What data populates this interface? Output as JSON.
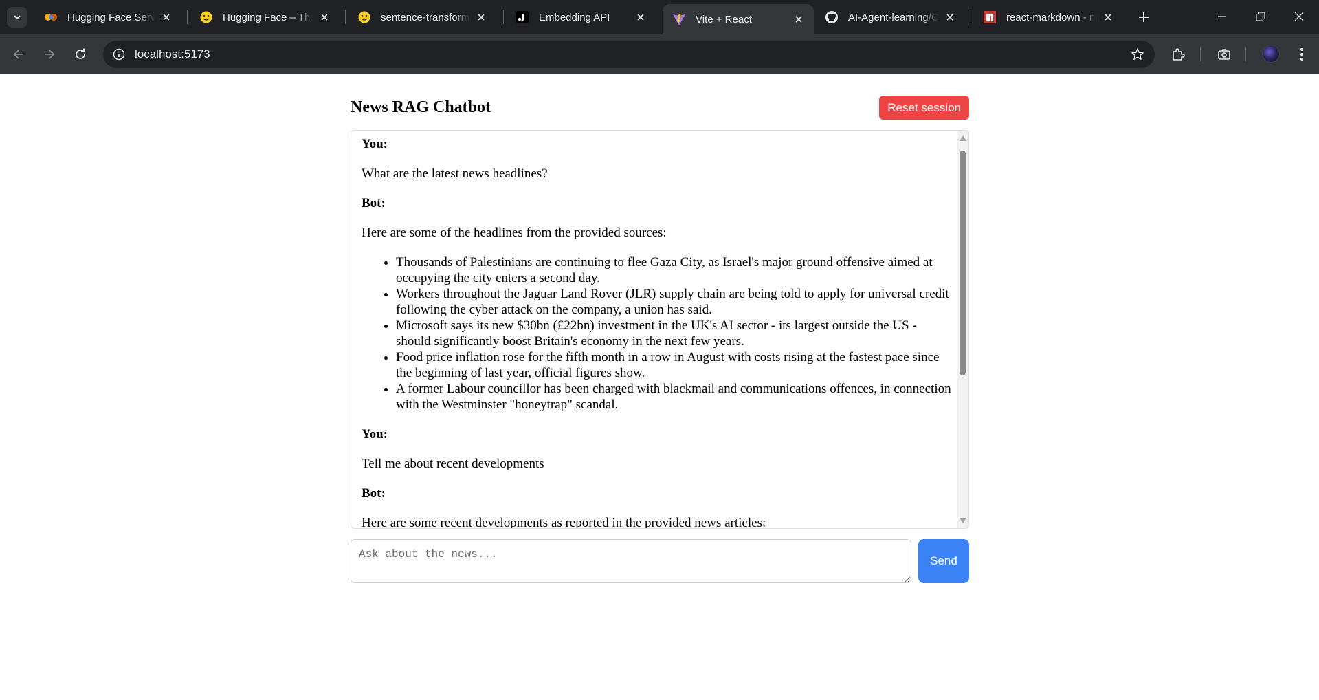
{
  "browser": {
    "tabs": [
      {
        "title": "Hugging Face Server",
        "icon": "google-colab-icon"
      },
      {
        "title": "Hugging Face – The AI community",
        "icon": "hugging-face-icon"
      },
      {
        "title": "sentence-transformers",
        "icon": "hugging-face-icon"
      },
      {
        "title": "Embedding API",
        "icon": "jina-icon"
      },
      {
        "title": "Vite + React",
        "icon": "vite-icon",
        "active": true
      },
      {
        "title": "AI-Agent-learning/Chatbot",
        "icon": "github-icon"
      },
      {
        "title": "react-markdown - npm",
        "icon": "npm-icon"
      }
    ],
    "url": "localhost:5173"
  },
  "app": {
    "title": "News RAG Chatbot",
    "reset_label": "Reset session",
    "send_label": "Send",
    "input_placeholder": "Ask about the news...",
    "input_value": ""
  },
  "messages": [
    {
      "role": "You:",
      "text": "What are the latest news headlines?"
    },
    {
      "role": "Bot:",
      "text": "Here are some of the headlines from the provided sources:",
      "bullets": [
        "Thousands of Palestinians are continuing to flee Gaza City, as Israel's major ground offensive aimed at occupying the city enters a second day.",
        "Workers throughout the Jaguar Land Rover (JLR) supply chain are being told to apply for universal credit following the cyber attack on the company, a union has said.",
        "Microsoft says its new $30bn (£22bn) investment in the UK's AI sector - its largest outside the US - should significantly boost Britain's economy in the next few years.",
        "Food price inflation rose for the fifth month in a row in August with costs rising at the fastest pace since the beginning of last year, official figures show.",
        "A former Labour councillor has been charged with blackmail and communications offences, in connection with the Westminster \"honeytrap\" scandal."
      ]
    },
    {
      "role": "You:",
      "text": "Tell me about recent developments"
    },
    {
      "role": "Bot:",
      "text": "Here are some recent developments as reported in the provided news articles:"
    }
  ],
  "colors": {
    "reset_button": "#ef4444",
    "send_button": "#3b82f6",
    "chrome_dark": "#202124",
    "chrome_toolbar": "#35363a"
  }
}
